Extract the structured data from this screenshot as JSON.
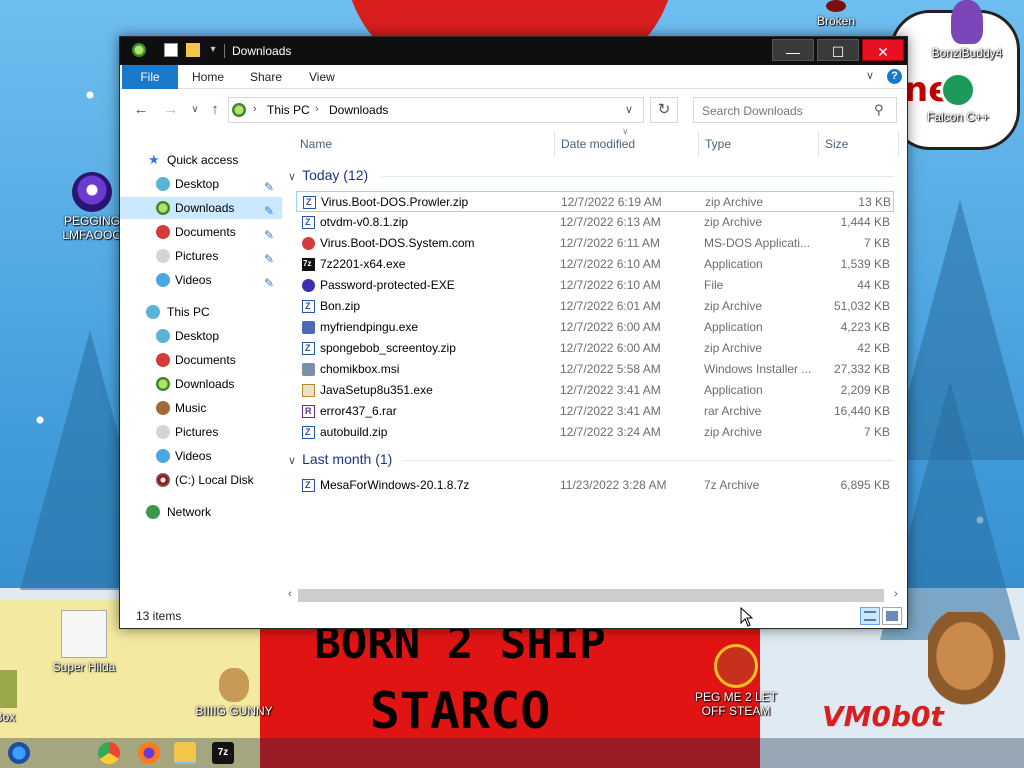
{
  "desktop": {
    "icons": {
      "broken": "Broken",
      "bonzibuddy": "BonziBuddy4",
      "falcon": "Falcon C++",
      "pegging": "PEGGING LMFAOOO",
      "super_hilda": "Super Hilda",
      "biiiig_gunny": "BIIIIG GUNNY",
      "peg_me": "PEG ME 2 LET OFF STEAM",
      "kbox": "kBox"
    },
    "wallpaper_text": {
      "born": "BORN 2 SHIP",
      "starco": "STARCO",
      "vmobot": "VM0b0t",
      "sign": "net"
    }
  },
  "window": {
    "title": "Downloads",
    "ribbon_tabs": [
      "File",
      "Home",
      "Share",
      "View"
    ],
    "help_label": "?",
    "caption": {
      "minimize": "—",
      "maximize": "☐",
      "close": "✕"
    },
    "address": {
      "root": "This PC",
      "current": "Downloads"
    },
    "search_placeholder": "Search Downloads",
    "nav": {
      "quick_access": "Quick access",
      "quick_items": [
        "Desktop",
        "Downloads",
        "Documents",
        "Pictures",
        "Videos"
      ],
      "this_pc": "This PC",
      "pc_items": [
        "Desktop",
        "Documents",
        "Downloads",
        "Music",
        "Pictures",
        "Videos",
        "(C:) Local Disk"
      ],
      "network": "Network"
    },
    "columns": {
      "name": "Name",
      "date": "Date modified",
      "type": "Type",
      "size": "Size"
    },
    "groups": {
      "today": "Today (12)",
      "last_month": "Last month (1)"
    },
    "files_today": [
      {
        "name": "Virus.Boot-DOS.Prowler.zip",
        "date": "12/7/2022 6:19 AM",
        "type": "zip Archive",
        "size": "13 KB",
        "icon": "zip-icon"
      },
      {
        "name": "otvdm-v0.8.1.zip",
        "date": "12/7/2022 6:13 AM",
        "type": "zip Archive",
        "size": "1,444 KB",
        "icon": "zip-icon"
      },
      {
        "name": "Virus.Boot-DOS.System.com",
        "date": "12/7/2022 6:11 AM",
        "type": "MS-DOS Applicati...",
        "size": "7 KB",
        "icon": "com-icon"
      },
      {
        "name": "7z2201-x64.exe",
        "date": "12/7/2022 6:10 AM",
        "type": "Application",
        "size": "1,539 KB",
        "icon": "7z-icon"
      },
      {
        "name": "Password-protected-EXE",
        "date": "12/7/2022 6:10 AM",
        "type": "File",
        "size": "44 KB",
        "icon": "blue-orb-icon"
      },
      {
        "name": "Bon.zip",
        "date": "12/7/2022 6:01 AM",
        "type": "zip Archive",
        "size": "51,032 KB",
        "icon": "zip-icon"
      },
      {
        "name": "myfriendpingu.exe",
        "date": "12/7/2022 6:00 AM",
        "type": "Application",
        "size": "4,223 KB",
        "icon": "exe-icon"
      },
      {
        "name": "spongebob_screentoy.zip",
        "date": "12/7/2022 6:00 AM",
        "type": "zip Archive",
        "size": "42 KB",
        "icon": "zip-icon"
      },
      {
        "name": "chomikbox.msi",
        "date": "12/7/2022 5:58 AM",
        "type": "Windows Installer ...",
        "size": "27,332 KB",
        "icon": "msi-icon"
      },
      {
        "name": "JavaSetup8u351.exe",
        "date": "12/7/2022 3:41 AM",
        "type": "Application",
        "size": "2,209 KB",
        "icon": "java-icon"
      },
      {
        "name": "error437_6.rar",
        "date": "12/7/2022 3:41 AM",
        "type": "rar Archive",
        "size": "16,440 KB",
        "icon": "rar-icon"
      },
      {
        "name": "autobuild.zip",
        "date": "12/7/2022 3:24 AM",
        "type": "zip Archive",
        "size": "7 KB",
        "icon": "zip-icon"
      }
    ],
    "files_last_month": [
      {
        "name": "MesaForWindows-20.1.8.7z",
        "date": "11/23/2022 3:28 AM",
        "type": "7z Archive",
        "size": "6,895 KB",
        "icon": "zip-icon"
      }
    ],
    "status": "13 items"
  }
}
